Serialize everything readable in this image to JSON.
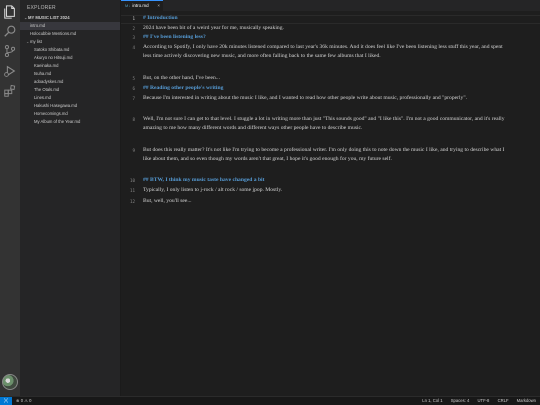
{
  "sidebar": {
    "title": "EXPLORER",
    "section": "MY MUSIC LIST 2024",
    "items": [
      {
        "label": "intro.md",
        "level": 1,
        "active": true
      },
      {
        "label": "Holocubbie Mentions.md",
        "level": 1
      },
      {
        "label": "my list",
        "level": 1,
        "folder": true
      },
      {
        "label": "Satoko Shibata.md",
        "level": 2
      },
      {
        "label": "Akuryo no Hitsuji.md",
        "level": 2
      },
      {
        "label": "Kaeinaka.md",
        "level": 2
      },
      {
        "label": "tsuha.md",
        "level": 2
      },
      {
        "label": "adoadyskes.md",
        "level": 2
      },
      {
        "label": "The Otals.md",
        "level": 2
      },
      {
        "label": "Lines.md",
        "level": 2
      },
      {
        "label": "Hakushi Hasegawa.md",
        "level": 2
      },
      {
        "label": "Homecomings.md",
        "level": 2
      },
      {
        "label": "My Album of the Year.md",
        "level": 2
      }
    ]
  },
  "tab": {
    "label": "intro.md",
    "icon": "M↓",
    "close": "×"
  },
  "editor": {
    "lines": [
      {
        "n": "1",
        "text": "# Introduction",
        "heading": true
      },
      {
        "n": "2",
        "text": "2024 have been bit of a weird year for me, musically speaking."
      },
      {
        "n": "3",
        "text": "## I've been listening less?",
        "heading": true
      },
      {
        "n": "4",
        "text": "According to Spotify, I only have 20k minutes listened compared to last year's 36k minutes. And it does feel like I've been listening less stuff this year, and spent less time actively discovering new music, and more often falling back to the same few albums that I liked."
      },
      {
        "n": "5",
        "text": "But, on the other hand, I've been..."
      },
      {
        "n": "6",
        "text": "## Reading other people's writing",
        "heading": true
      },
      {
        "n": "7",
        "text": "Because I'm interested in writing about the music I like, and I wanted to read how other people write about music, professionally and \"properly\"."
      },
      {
        "n": "8",
        "text": "Well, I'm not sure I can get to that level. I stuggle a lot in writing more than just \"This sounds good\" and \"I like this\". I'm not a good communicator, and it's really amazing to me how many different words and different ways other people have to describe music."
      },
      {
        "n": "9",
        "text": "But does this really matter? It's not like I'm trying to become a professional writer. I'm only doing this to note down the music I like, and trying to describe what I like about them, and so even though my words aren't that great, I hope it's good enough for you, my future self."
      },
      {
        "n": "10",
        "text": "## BTW, I think my music taste have changed a bit",
        "heading": true
      },
      {
        "n": "11",
        "text": "Typically, I only listen to j-rock / alt rock / some jpop. Mostly."
      },
      {
        "n": "12",
        "text": "But, well, you'll see..."
      }
    ]
  },
  "status": {
    "remote_icon": "remote-icon",
    "errors": "0",
    "warnings": "0",
    "position": "Ln 1, Col 1",
    "spaces": "Spaces: 4",
    "encoding": "UTF-8",
    "eol": "CRLF",
    "language": "Markdown"
  },
  "colors": {
    "accent": "#3794ff",
    "heading": "#569cd6",
    "remote": "#0078d4"
  }
}
